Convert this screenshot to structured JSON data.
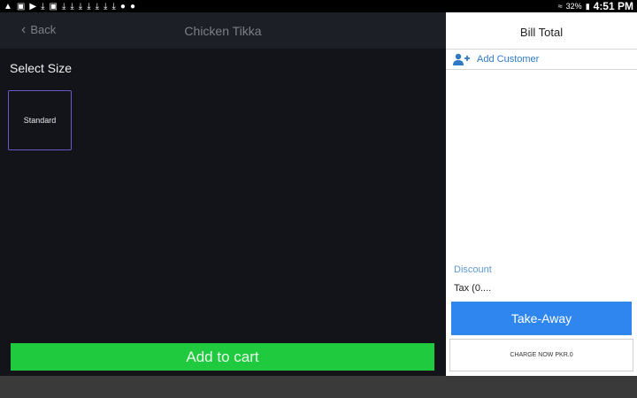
{
  "status_bar": {
    "icons": [
      "warning-icon",
      "image-icon",
      "youtube-icon",
      "download-icon",
      "gallery-icon",
      "download-icon",
      "download-icon",
      "download-icon",
      "download-icon",
      "download-icon",
      "download-icon",
      "download-icon",
      "keyhole-icon",
      "keyhole-icon"
    ],
    "battery": "32%",
    "time": "4:51 PM"
  },
  "header": {
    "back_label": "Back",
    "title": "Chicken Tikka"
  },
  "size_section": {
    "heading": "Select Size",
    "options": [
      "Standard"
    ]
  },
  "add_to_cart_label": "Add to cart",
  "bill": {
    "title": "Bill Total",
    "add_customer_label": "Add Customer",
    "discount_label": "Discount",
    "tax_label": "Tax (0....",
    "takeaway_label": "Take-Away",
    "charge_label": "CHARGE NOW PKR.0"
  },
  "colors": {
    "accent_green": "#1fca3e",
    "accent_blue": "#2f86ef",
    "size_border": "#6e57c8",
    "link_blue": "#2f79c4"
  }
}
